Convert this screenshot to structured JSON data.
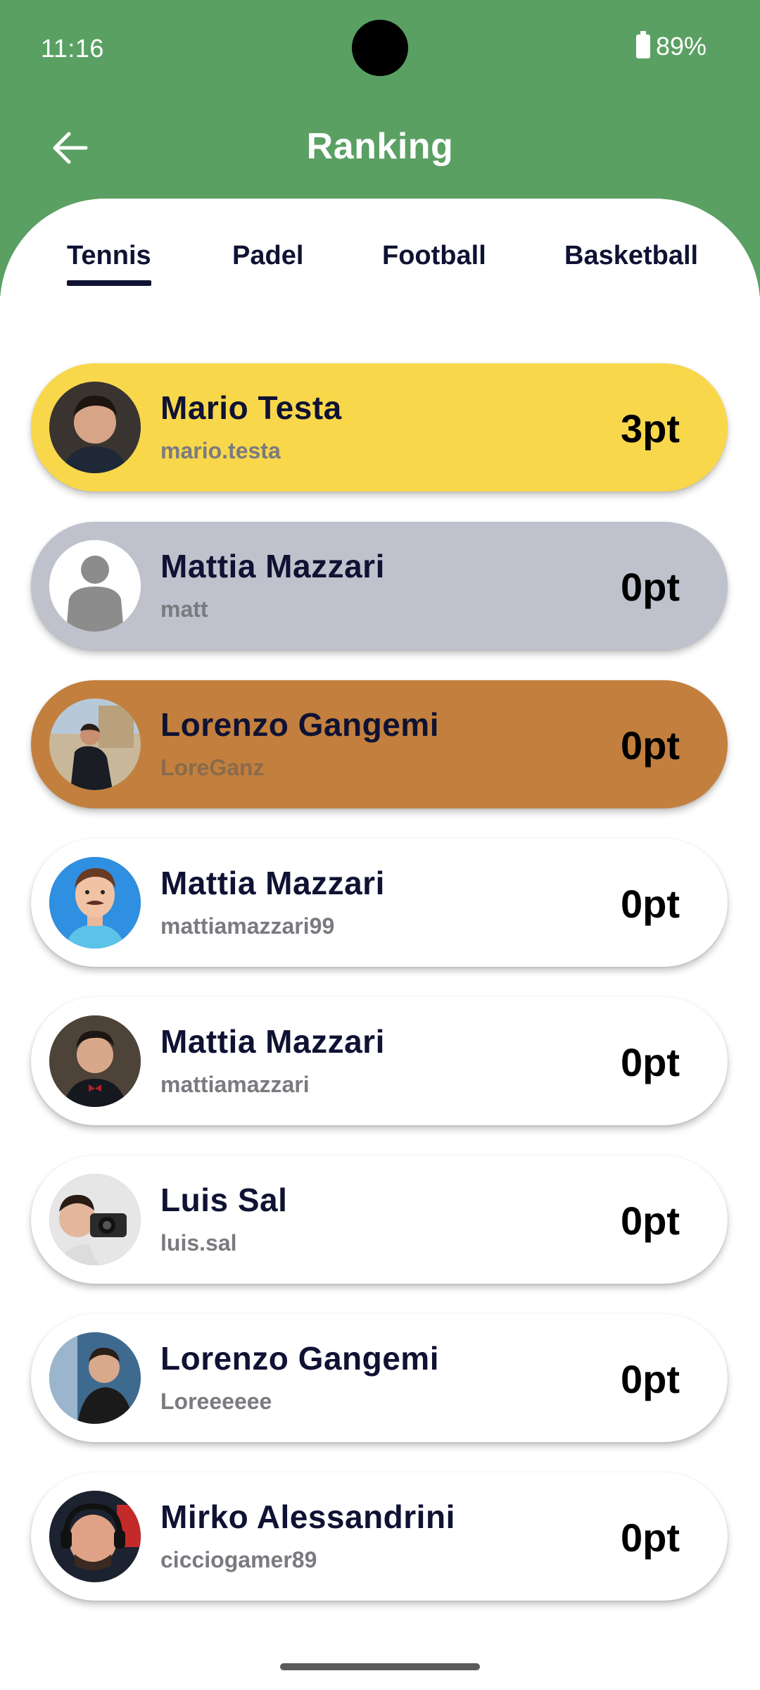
{
  "status": {
    "time": "11:16",
    "battery": "89%"
  },
  "app": {
    "title": "Ranking"
  },
  "tabs": [
    {
      "label": "Tennis",
      "selected": true
    },
    {
      "label": "Padel",
      "selected": false
    },
    {
      "label": "Football",
      "selected": false
    },
    {
      "label": "Basketball",
      "selected": false
    }
  ],
  "colors": {
    "header_green": "#5aa063",
    "gold": "#f8d74b",
    "silver": "#bfc2cc",
    "bronze": "#c27f3e",
    "text_dark": "#0f1233"
  },
  "ranking": [
    {
      "name": "Mario Testa",
      "username": "mario.testa",
      "points": "3pt"
    },
    {
      "name": "Mattia Mazzari",
      "username": "matt",
      "points": "0pt"
    },
    {
      "name": "Lorenzo Gangemi",
      "username": "LoreGanz",
      "points": "0pt"
    },
    {
      "name": "Mattia Mazzari",
      "username": "mattiamazzari99",
      "points": "0pt"
    },
    {
      "name": "Mattia Mazzari",
      "username": "mattiamazzari",
      "points": "0pt"
    },
    {
      "name": "Luis Sal",
      "username": "luis.sal",
      "points": "0pt"
    },
    {
      "name": "Lorenzo Gangemi",
      "username": "Loreeeeee",
      "points": "0pt"
    },
    {
      "name": "Mirko Alessandrini",
      "username": "cicciogamer89",
      "points": "0pt"
    }
  ]
}
